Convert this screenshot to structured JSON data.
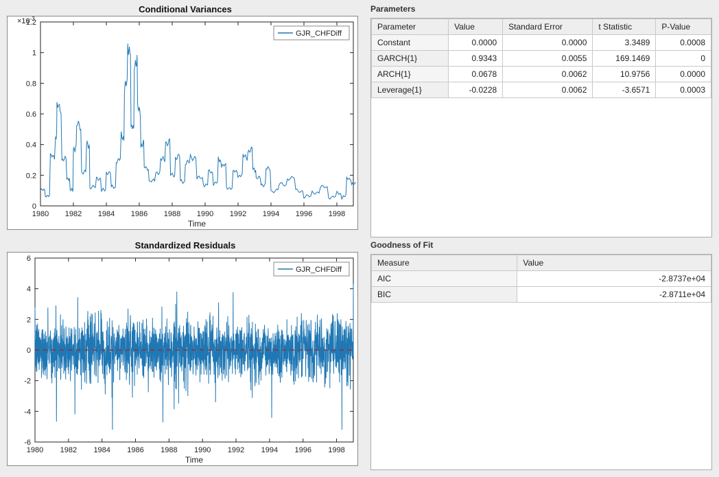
{
  "chart1": {
    "title": "Conditional Variances",
    "legend": "GJR_CHFDiff",
    "xlabel": "Time",
    "y_exp": "×10",
    "y_exp_sup": "-3",
    "x_ticks": [
      1980,
      1982,
      1984,
      1986,
      1988,
      1990,
      1992,
      1994,
      1996,
      1998
    ],
    "y_ticks": [
      0,
      0.2,
      0.4,
      0.6,
      0.8,
      1,
      1.2
    ]
  },
  "chart2": {
    "title": "Standardized Residuals",
    "legend": "GJR_CHFDiff",
    "xlabel": "Time",
    "x_ticks": [
      1980,
      1982,
      1984,
      1986,
      1988,
      1990,
      1992,
      1994,
      1996,
      1998
    ],
    "y_ticks": [
      -6,
      -4,
      -2,
      0,
      2,
      4,
      6
    ]
  },
  "parameters": {
    "title": "Parameters",
    "headers": [
      "Parameter",
      "Value",
      "Standard Error",
      "t Statistic",
      "P-Value"
    ],
    "rows": [
      [
        "Constant",
        "0.0000",
        "0.0000",
        "3.3489",
        "0.0008"
      ],
      [
        "GARCH{1}",
        "0.9343",
        "0.0055",
        "169.1469",
        "0"
      ],
      [
        "ARCH{1}",
        "0.0678",
        "0.0062",
        "10.9756",
        "0.0000"
      ],
      [
        "Leverage{1}",
        "-0.0228",
        "0.0062",
        "-3.6571",
        "0.0003"
      ]
    ]
  },
  "gof": {
    "title": "Goodness of Fit",
    "headers": [
      "Measure",
      "Value"
    ],
    "rows": [
      [
        "AIC",
        "-2.8737e+04"
      ],
      [
        "BIC",
        "-2.8711e+04"
      ]
    ]
  },
  "chart_data": [
    {
      "type": "line",
      "title": "Conditional Variances",
      "xlabel": "Time",
      "ylabel": "",
      "xlim": [
        1980,
        1999
      ],
      "ylim": [
        0,
        0.0012
      ],
      "series": [
        {
          "name": "GJR_CHFDiff",
          "x": [
            1980.0,
            1980.3,
            1980.6,
            1980.9,
            1981.0,
            1981.3,
            1981.6,
            1981.8,
            1982.0,
            1982.2,
            1982.5,
            1982.8,
            1983.0,
            1983.4,
            1983.7,
            1984.0,
            1984.3,
            1984.6,
            1984.9,
            1985.1,
            1985.3,
            1985.5,
            1985.7,
            1985.9,
            1986.1,
            1986.3,
            1986.6,
            1987.0,
            1987.3,
            1987.6,
            1987.9,
            1988.2,
            1988.5,
            1988.8,
            1989.1,
            1989.5,
            1989.9,
            1990.2,
            1990.5,
            1990.8,
            1991.0,
            1991.3,
            1991.7,
            1992.0,
            1992.3,
            1992.6,
            1992.9,
            1993.1,
            1993.4,
            1993.7,
            1994.0,
            1994.5,
            1995.0,
            1995.5,
            1996.0,
            1996.5,
            1997.0,
            1997.5,
            1998.0,
            1998.3,
            1998.6,
            1998.9
          ],
          "values_e3": [
            0.1,
            0.07,
            0.32,
            0.45,
            0.65,
            0.3,
            0.18,
            0.1,
            0.38,
            0.52,
            0.22,
            0.4,
            0.12,
            0.18,
            0.1,
            0.22,
            0.12,
            0.3,
            0.45,
            0.78,
            1.04,
            0.5,
            0.95,
            0.62,
            0.4,
            0.25,
            0.16,
            0.22,
            0.3,
            0.42,
            0.2,
            0.32,
            0.16,
            0.28,
            0.32,
            0.18,
            0.14,
            0.22,
            0.15,
            0.3,
            0.26,
            0.12,
            0.22,
            0.2,
            0.32,
            0.36,
            0.24,
            0.18,
            0.14,
            0.24,
            0.1,
            0.14,
            0.18,
            0.1,
            0.06,
            0.09,
            0.12,
            0.06,
            0.08,
            0.06,
            0.18,
            0.14
          ]
        }
      ]
    },
    {
      "type": "line",
      "title": "Standardized Residuals",
      "xlabel": "Time",
      "ylabel": "",
      "xlim": [
        1980,
        1999
      ],
      "ylim": [
        -6,
        6
      ],
      "reference_line": 0,
      "series": [
        {
          "name": "GJR_CHFDiff",
          "description": "high-frequency residuals oscillating roughly between -5 and 4 with mean near 0"
        }
      ]
    }
  ]
}
